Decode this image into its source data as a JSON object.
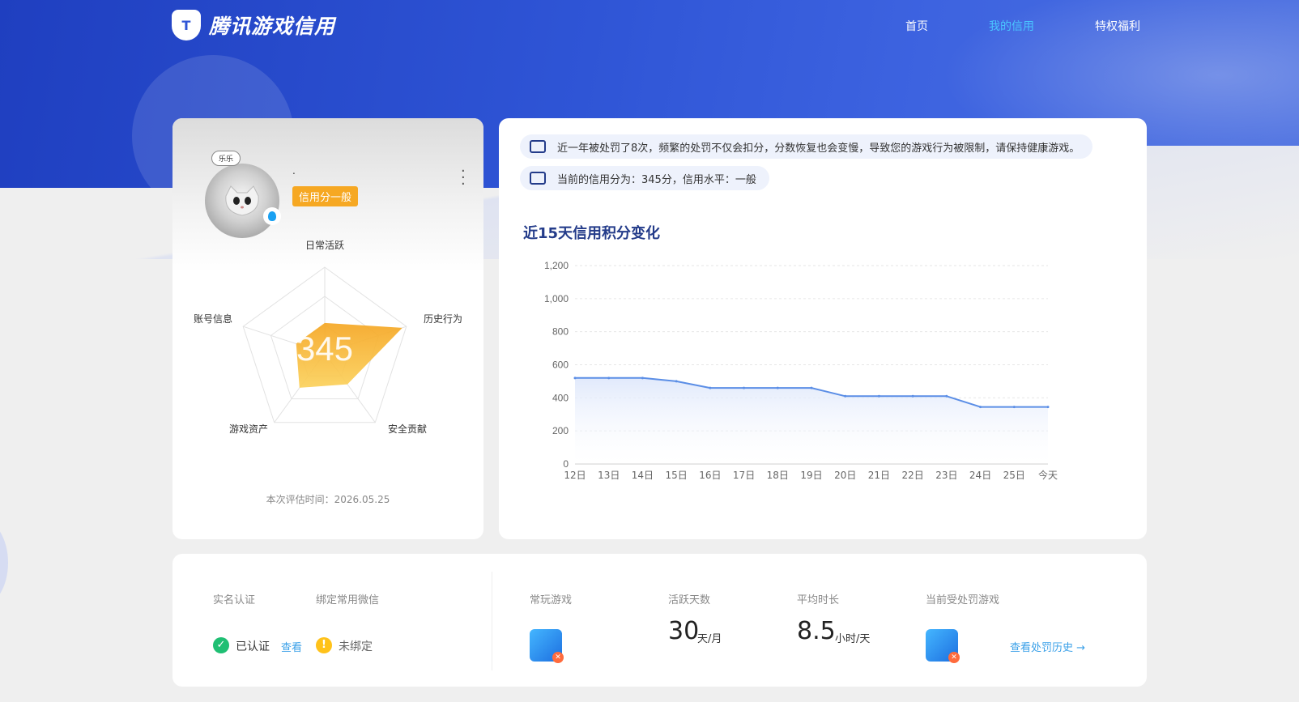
{
  "header": {
    "brand": "腾讯游戏信用",
    "nav": [
      {
        "label": "首页"
      },
      {
        "label": "我的信用"
      },
      {
        "label": "特权福利"
      }
    ]
  },
  "profile": {
    "avatar_bubble": "乐乐",
    "name": ".",
    "level_tag": "信用分一般",
    "score": "345",
    "radar_labels": {
      "top": "日常活跃",
      "right": "历史行为",
      "bottom_right": "安全贡献",
      "bottom_left": "游戏资产",
      "left": "账号信息"
    },
    "eval_time": "本次评估时间：2026.05.25"
  },
  "notices": [
    "近一年被处罚了8次，频繁的处罚不仅会扣分，分数恢复也会变慢，导致您的游戏行为被限制，请保持健康游戏。",
    "当前的信用分为：345分，信用水平：一般"
  ],
  "chart_title": "近15天信用积分变化",
  "chart_data": {
    "type": "area",
    "title": "近15天信用积分变化",
    "x": [
      "12日",
      "13日",
      "14日",
      "15日",
      "16日",
      "17日",
      "18日",
      "19日",
      "20日",
      "21日",
      "22日",
      "23日",
      "24日",
      "25日",
      "今天"
    ],
    "series": [
      {
        "values": [
          520,
          520,
          520,
          500,
          460,
          460,
          460,
          460,
          410,
          410,
          410,
          410,
          345,
          345,
          345
        ]
      }
    ],
    "ylim": [
      0,
      1200
    ],
    "yticks": [
      "0",
      "200",
      "400",
      "600",
      "800",
      "1,000",
      "1,200"
    ],
    "grid": true,
    "colors": {
      "line": "#5b8ee6",
      "fill": "#dfe8fb"
    }
  },
  "radar_data": {
    "values": [
      0.35,
      0.95,
      0.45,
      0.5,
      0.35
    ],
    "colors": {
      "fill_top": "#f5a623",
      "fill_bottom": "#fbd15b"
    }
  },
  "bottom": {
    "real_name_label": "实名认证",
    "wechat_label": "绑定常用微信",
    "real_name_status": "已认证",
    "view_link": "查看",
    "wechat_status": "未绑定",
    "frequent_games_label": "常玩游戏",
    "active_days_label": "活跃天数",
    "active_days_value": "30",
    "active_days_unit": "天/月",
    "avg_time_label": "平均时长",
    "avg_time_value": "8.5",
    "avg_time_unit": "小时/天",
    "punished_games_label": "当前受处罚游戏",
    "history_link": "查看处罚历史 →"
  },
  "colors": {
    "brand_blue": "#2f55d6",
    "nav_active": "#49c6ff",
    "tag_orange": "#f6a823",
    "title_navy": "#243c8a"
  }
}
